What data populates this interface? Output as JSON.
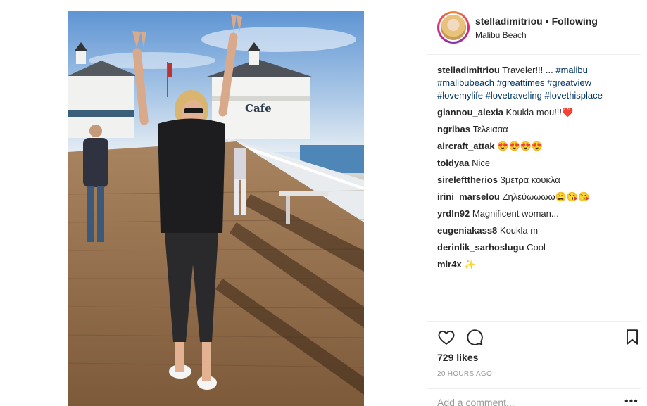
{
  "post": {
    "username": "stelladimitriou",
    "separator": "•",
    "follow_status": "Following",
    "location": "Malibu Beach",
    "caption": {
      "username": "stelladimitriou",
      "text": "Traveler!!! ...",
      "hashtags": [
        "#malibu",
        "#malibubeach",
        "#greattimes",
        "#greatview",
        "#lovemylife",
        "#lovetraveling",
        "#lovethisplace"
      ]
    },
    "comments": [
      {
        "user": "giannou_alexia",
        "text": "Koukla mou!!!❤️"
      },
      {
        "user": "ngribas",
        "text": "Τελειααα"
      },
      {
        "user": "aircraft_attak",
        "text": "😍😍😍😍"
      },
      {
        "user": "toldyaa",
        "text": "Nice"
      },
      {
        "user": "sirelefttherios",
        "text": "3μετρα κουκλα"
      },
      {
        "user": "irini_marselou",
        "text": "Ζηλεύωωωω😩😘😘"
      },
      {
        "user": "yrdln92",
        "text": "Magnificent woman..."
      },
      {
        "user": "eugeniakass8",
        "text": "Koukla m"
      },
      {
        "user": "derinlik_sarhoslugu",
        "text": "Cool"
      },
      {
        "user": "mlr4x",
        "text": "✨"
      }
    ],
    "likes": "729 likes",
    "timestamp": "20 HOURS AGO",
    "add_comment_placeholder": "Add a comment...",
    "more_label": "•••",
    "photo": {
      "sign_text": "Cafe"
    }
  },
  "icons": {
    "like": "heart-icon",
    "comment": "comment-bubble-icon",
    "save": "bookmark-icon"
  },
  "colors": {
    "hashtag": "#003569",
    "meta": "#999999",
    "text": "#262626"
  }
}
